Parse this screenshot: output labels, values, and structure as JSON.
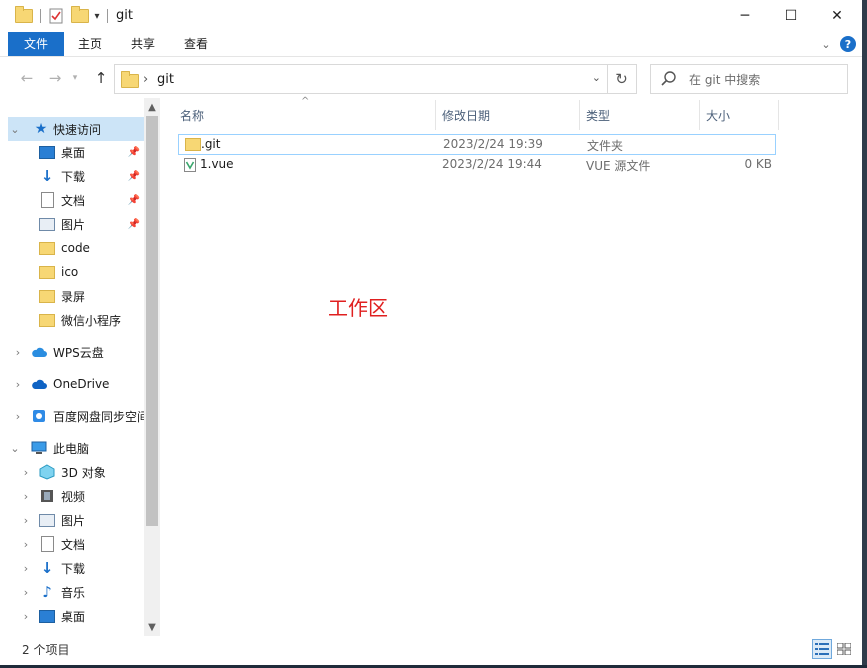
{
  "window": {
    "title": "git",
    "controls": {
      "minimize": "─",
      "maximize": "☐",
      "close": "✕"
    }
  },
  "ribbon": {
    "tabs": [
      "文件",
      "主页",
      "共享",
      "查看"
    ],
    "expand_glyph": "⌄",
    "help_glyph": "?"
  },
  "address": {
    "crumb": "git",
    "search_placeholder": "在 git 中搜索"
  },
  "nav": {
    "quick_access": "快速访问",
    "quick_items": [
      {
        "label": "桌面",
        "icon": "desktop-icon",
        "pinned": true
      },
      {
        "label": "下载",
        "icon": "download-icon",
        "pinned": true
      },
      {
        "label": "文档",
        "icon": "document-icon",
        "pinned": true
      },
      {
        "label": "图片",
        "icon": "picture-icon",
        "pinned": true
      },
      {
        "label": "code",
        "icon": "folder-icon",
        "pinned": false
      },
      {
        "label": "ico",
        "icon": "folder-icon",
        "pinned": false
      },
      {
        "label": "录屏",
        "icon": "folder-icon",
        "pinned": false
      },
      {
        "label": "微信小程序",
        "icon": "folder-icon",
        "pinned": false
      }
    ],
    "roots": [
      {
        "label": "WPS云盘",
        "icon": "cloud-icon"
      },
      {
        "label": "OneDrive",
        "icon": "onedrive-icon"
      },
      {
        "label": "百度网盘同步空间",
        "icon": "baidu-sync-icon"
      }
    ],
    "this_pc": "此电脑",
    "pc_items": [
      {
        "label": "3D 对象",
        "icon": "3d-objects-icon"
      },
      {
        "label": "视频",
        "icon": "video-icon"
      },
      {
        "label": "图片",
        "icon": "picture-icon"
      },
      {
        "label": "文档",
        "icon": "document-icon"
      },
      {
        "label": "下载",
        "icon": "download-icon"
      },
      {
        "label": "音乐",
        "icon": "music-icon"
      },
      {
        "label": "桌面",
        "icon": "desktop-icon"
      }
    ]
  },
  "columns": {
    "name": "名称",
    "modified": "修改日期",
    "type": "类型",
    "size": "大小"
  },
  "files": [
    {
      "name": ".git",
      "modified": "2023/2/24 19:39",
      "type": "文件夹",
      "size": "",
      "icon": "folder-icon"
    },
    {
      "name": "1.vue",
      "modified": "2023/2/24 19:44",
      "type": "VUE 源文件",
      "size": "0 KB",
      "icon": "vue-file-icon"
    }
  ],
  "annotation": "工作区",
  "status": {
    "count": "2 个项目"
  },
  "colors": {
    "accent": "#1a6fc9",
    "selection": "#cce4f7",
    "annotation": "#e02020"
  }
}
